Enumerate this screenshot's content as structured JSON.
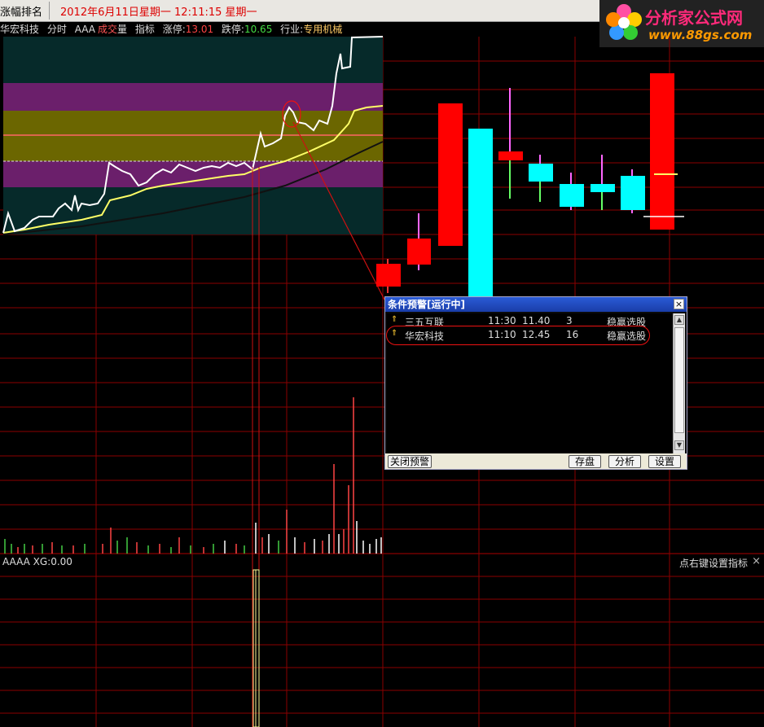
{
  "topbar": {
    "left_label": "涨幅排名",
    "datetime": "2012年6月11日星期一  12:11:15 星期一"
  },
  "logo": {
    "brand": "分析家公式网",
    "url": "www.88gs.com"
  },
  "infobar": {
    "stock_name": "华宏科技",
    "period": "分时",
    "formula": "AAA",
    "vol_label_a": "成交",
    "vol_label_b": "量",
    "indicator": "指标",
    "limit_up_label": "涨停:",
    "limit_up_value": "13.01",
    "limit_down_label": "跌停:",
    "limit_down_value": "10.65",
    "industry_label": "行业:",
    "industry_value": "专用机械"
  },
  "subchart": {
    "title": "AAAA  XG:0.00",
    "tip": "点右键设置指标",
    "close_glyph": "×"
  },
  "dialog": {
    "title": "条件预警[运行中]",
    "close_glyph": "×",
    "rows": [
      {
        "name": "三五互联",
        "time": "11:30",
        "price": "11.40",
        "count": "3",
        "strategy": "稳赢选股"
      },
      {
        "name": "华宏科技",
        "time": "11:10",
        "price": "12.45",
        "count": "16",
        "strategy": "稳赢选股"
      }
    ],
    "buttons": {
      "close_alert": "关闭预警",
      "save": "存盘",
      "analyze": "分析",
      "settings": "设置"
    }
  },
  "colors": {
    "up": "#ff0000",
    "down": "#00ffff",
    "price_line": "#ffffff",
    "avg_line": "#ffff66",
    "band_purple": "#6b1f6b",
    "band_olive": "#6b6600",
    "grid": "#8b0000",
    "window_title": "#1a3da8"
  },
  "icons": {
    "row_marker": "up-arrow-icon"
  }
}
